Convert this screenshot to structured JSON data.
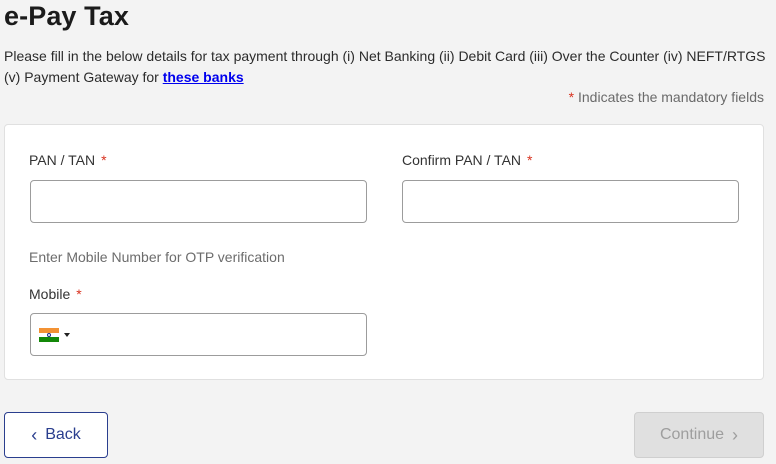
{
  "page": {
    "title": "e-Pay Tax",
    "intro_text": "Please fill in the below details for tax payment through (i) Net Banking (ii) Debit Card (iii) Over the Counter (iv) NEFT/RTGS (v) Payment Gateway for ",
    "intro_link": "these banks",
    "mandatory_star": "*",
    "mandatory_note": " Indicates the mandatory fields"
  },
  "form": {
    "pan_label": "PAN / TAN",
    "pan_value": "",
    "confirm_pan_label": "Confirm PAN / TAN",
    "confirm_pan_value": "",
    "required_star": "*",
    "otp_hint": "Enter Mobile Number for OTP verification",
    "mobile_label": "Mobile",
    "mobile_value": "",
    "country_flag_icon": "india-flag-icon"
  },
  "actions": {
    "back_label": "Back",
    "back_icon": "‹",
    "continue_label": "Continue",
    "continue_icon": "›"
  },
  "colors": {
    "required_star": "#d8321f",
    "link": "#0000ee",
    "primary": "#2a3e8e",
    "disabled_bg": "#e0e0e0"
  }
}
